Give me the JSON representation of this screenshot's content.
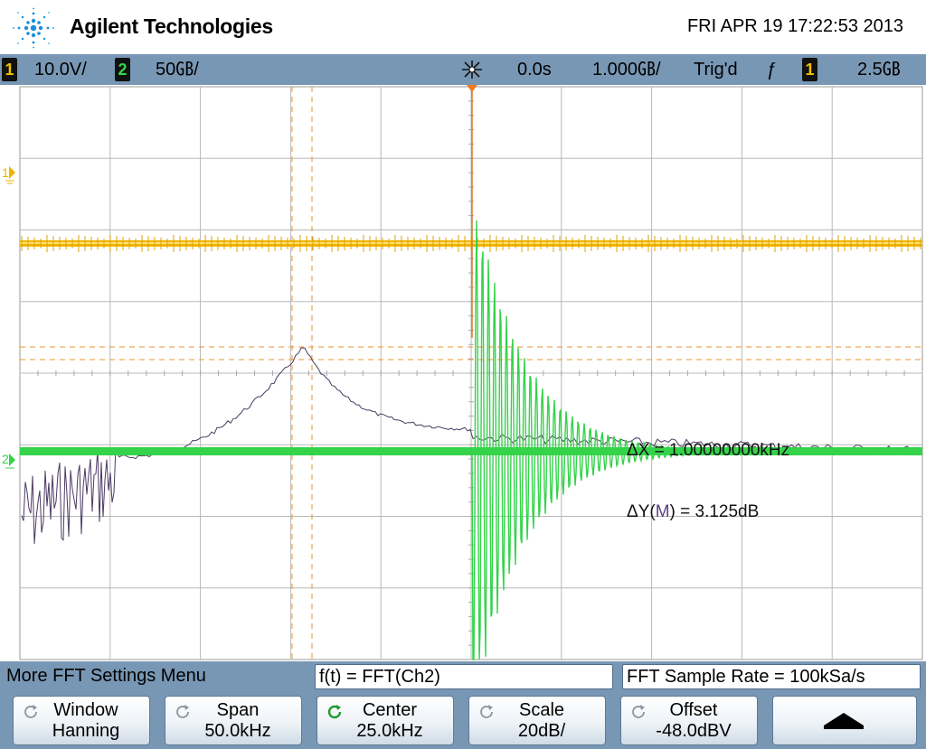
{
  "header": {
    "brand": "Agilent Technologies",
    "datetime": "FRI APR 19 17:22:53 2013"
  },
  "status": {
    "ch1_badge": "1",
    "ch1_scale": "10.0V/",
    "ch2_badge": "2",
    "ch2_scale": "50㎇/",
    "time_delay": "0.0s",
    "time_scale": "1.000㎇/",
    "trig_state": "Trig'd",
    "trig_edge": "ƒ",
    "trig_badge": "1",
    "trig_level": "2.5㎇"
  },
  "markers": {
    "ch1_marker": "1",
    "ch2_marker": "2"
  },
  "measurements": {
    "delta_x_prefix": "ΔX = ",
    "delta_x": "1.00000000kHz",
    "delta_y_prefix": "ΔY(",
    "delta_y_source": "M",
    "delta_y_suffix": ") = ",
    "delta_y": "3.125dB"
  },
  "menu": {
    "title": "More FFT Settings Menu",
    "function": "f(t) = FFT(Ch2)",
    "sample_rate": "FFT Sample Rate = 100kSa/s",
    "softkeys": [
      {
        "label": "Window",
        "value": "Hanning"
      },
      {
        "label": "Span",
        "value": "50.0kHz"
      },
      {
        "label": "Center",
        "value": "25.0kHz"
      },
      {
        "label": "Scale",
        "value": "20dB/"
      },
      {
        "label": "Offset",
        "value": "-48.0dBV"
      }
    ],
    "back_icon": "up-arrow-icon"
  },
  "colors": {
    "ch1": "#f0b400",
    "ch2": "#34d34a",
    "math": "#4b3a63",
    "cursor": "#e8962f",
    "bar": "#7897b5"
  }
}
